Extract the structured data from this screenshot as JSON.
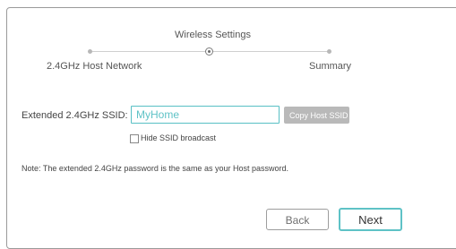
{
  "wizard": {
    "current_step_title": "Wireless Settings",
    "step_first_label": "2.4GHz Host Network",
    "step_last_label": "Summary"
  },
  "form": {
    "ssid_label": "Extended 2.4GHz SSID:",
    "ssid_value": "MyHome",
    "copy_button_label": "Copy Host SSID",
    "hide_ssid_label": "Hide SSID broadcast",
    "hide_ssid_checked": false,
    "note": "Note: The extended 2.4GHz password is the same as your Host password."
  },
  "footer": {
    "back_label": "Back",
    "next_label": "Next"
  },
  "colors": {
    "accent": "#5ec2c6",
    "disabled_button": "#b9b9b9"
  }
}
